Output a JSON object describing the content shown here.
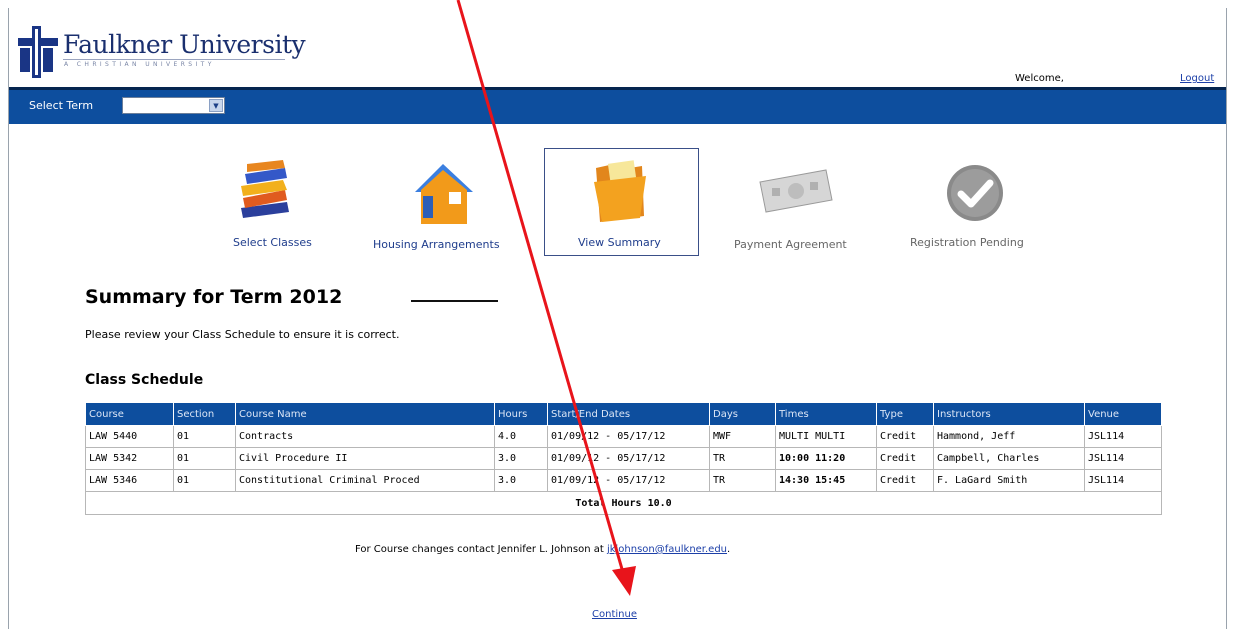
{
  "header": {
    "university_name": "Faulkner University",
    "tagline": "A CHRISTIAN UNIVERSITY",
    "welcome_text": "Welcome,",
    "logout_label": "Logout"
  },
  "term_bar": {
    "label": "Select Term",
    "selected_value": ""
  },
  "steps": [
    {
      "label": "Select Classes",
      "icon": "books-icon"
    },
    {
      "label": "Housing Arrangements",
      "icon": "house-icon"
    },
    {
      "label": "View Summary",
      "icon": "folder-icon"
    },
    {
      "label": "Payment Agreement",
      "icon": "money-icon"
    },
    {
      "label": "Registration Pending",
      "icon": "checkmark-icon"
    }
  ],
  "summary": {
    "title": "Summary for Term 2012",
    "note": "Please review your Class Schedule to ensure it is correct.",
    "schedule_title": "Class Schedule"
  },
  "table": {
    "headers": [
      "Course",
      "Section",
      "Course Name",
      "Hours",
      "Start/End Dates",
      "Days",
      "Times",
      "Type",
      "Instructors",
      "Venue"
    ],
    "rows": [
      [
        "LAW 5440",
        "01",
        "Contracts",
        "4.0",
        "01/09/12 - 05/17/12",
        "MWF",
        "MULTI MULTI",
        "Credit",
        "Hammond, Jeff",
        "JSL114"
      ],
      [
        "LAW 5342",
        "01",
        "Civil Procedure II",
        "3.0",
        "01/09/12 - 05/17/12",
        "TR",
        "10:00 11:20",
        "Credit",
        "Campbell, Charles",
        "JSL114"
      ],
      [
        "LAW 5346",
        "01",
        "Constitutional Criminal Proced",
        "3.0",
        "01/09/12 - 05/17/12",
        "TR",
        "14:30 15:45",
        "Credit",
        "F. LaGard Smith",
        "JSL114"
      ]
    ],
    "total": "Total Hours 10.0"
  },
  "contact": {
    "text": "For Course changes contact Jennifer L. Johnson at ",
    "email": "jkjohnson@faulkner.edu",
    "suffix": "."
  },
  "continue_label": "Continue",
  "colors": {
    "brand_blue": "#0d4e9e",
    "link_blue": "#1c3fa8",
    "annotation_arrow": "#e8141b"
  }
}
